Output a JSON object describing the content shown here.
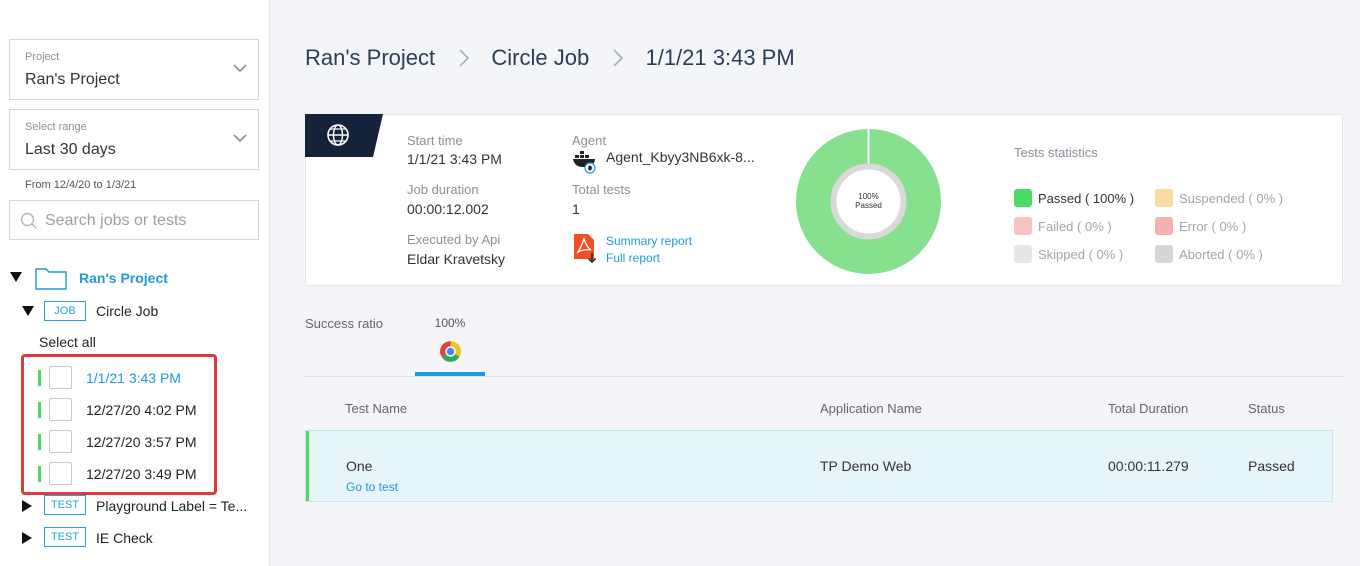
{
  "sidebar": {
    "project_select": {
      "label": "Project",
      "value": "Ran's Project"
    },
    "range_select": {
      "label": "Select range",
      "value": "Last 30 days"
    },
    "range_note": "From 12/4/20 to 1/3/21",
    "search": {
      "placeholder": "Search jobs or tests"
    },
    "tree": {
      "project": "Ran's Project",
      "job_tag": "JOB",
      "job_name": "Circle Job",
      "select_all": "Select all",
      "runs": [
        "1/1/21 3:43 PM",
        "12/27/20 4:02 PM",
        "12/27/20 3:57 PM",
        "12/27/20 3:49 PM"
      ],
      "tests": [
        {
          "tag": "TEST",
          "name": "Playground Label = Te..."
        },
        {
          "tag": "TEST",
          "name": "IE Check"
        }
      ]
    }
  },
  "breadcrumb": [
    "Ran's Project",
    "Circle Job",
    "1/1/21 3:43 PM"
  ],
  "summary": {
    "start_time_label": "Start time",
    "start_time": "1/1/21 3:43 PM",
    "duration_label": "Job duration",
    "duration": "00:00:12.002",
    "executed_label": "Executed by Api",
    "executed_by": "Eldar Kravetsky",
    "agent_label": "Agent",
    "agent": "Agent_Kbyy3NB6xk-8...",
    "total_tests_label": "Total tests",
    "total_tests": "1",
    "summary_report": "Summary report",
    "full_report": "Full report",
    "donut_pct": "100%",
    "donut_status": "Passed",
    "donut_fraction": 1.0,
    "stats_title": "Tests statistics",
    "stats": [
      {
        "label": "Passed ( 100% )",
        "color": "#4cd964",
        "text_color": "#333333"
      },
      {
        "label": "Suspended ( 0% )",
        "color": "#fbd9a5",
        "text_color": "#a0a6ad"
      },
      {
        "label": "Failed ( 0% )",
        "color": "#f7c3c3",
        "text_color": "#a0a6ad"
      },
      {
        "label": "Error ( 0% )",
        "color": "#f3b1b1",
        "text_color": "#a0a6ad"
      },
      {
        "label": "Skipped ( 0% )",
        "color": "#e6e6e6",
        "text_color": "#a0a6ad"
      },
      {
        "label": "Aborted ( 0% )",
        "color": "#d6d6d6",
        "text_color": "#a0a6ad"
      }
    ]
  },
  "tabs": {
    "success_label": "Success ratio",
    "chrome_pct": "100%"
  },
  "table": {
    "headers": [
      "Test Name",
      "Application Name",
      "Total Duration",
      "Status"
    ],
    "rows": [
      {
        "name": "One",
        "link": "Go to test",
        "app": "TP Demo Web",
        "duration": "00:00:11.279",
        "status": "Passed"
      }
    ]
  },
  "colors": {
    "accent": "#1f9bd6",
    "passed": "#4cd964",
    "donut": "#86e08e",
    "highlight": "#e03a3a"
  }
}
